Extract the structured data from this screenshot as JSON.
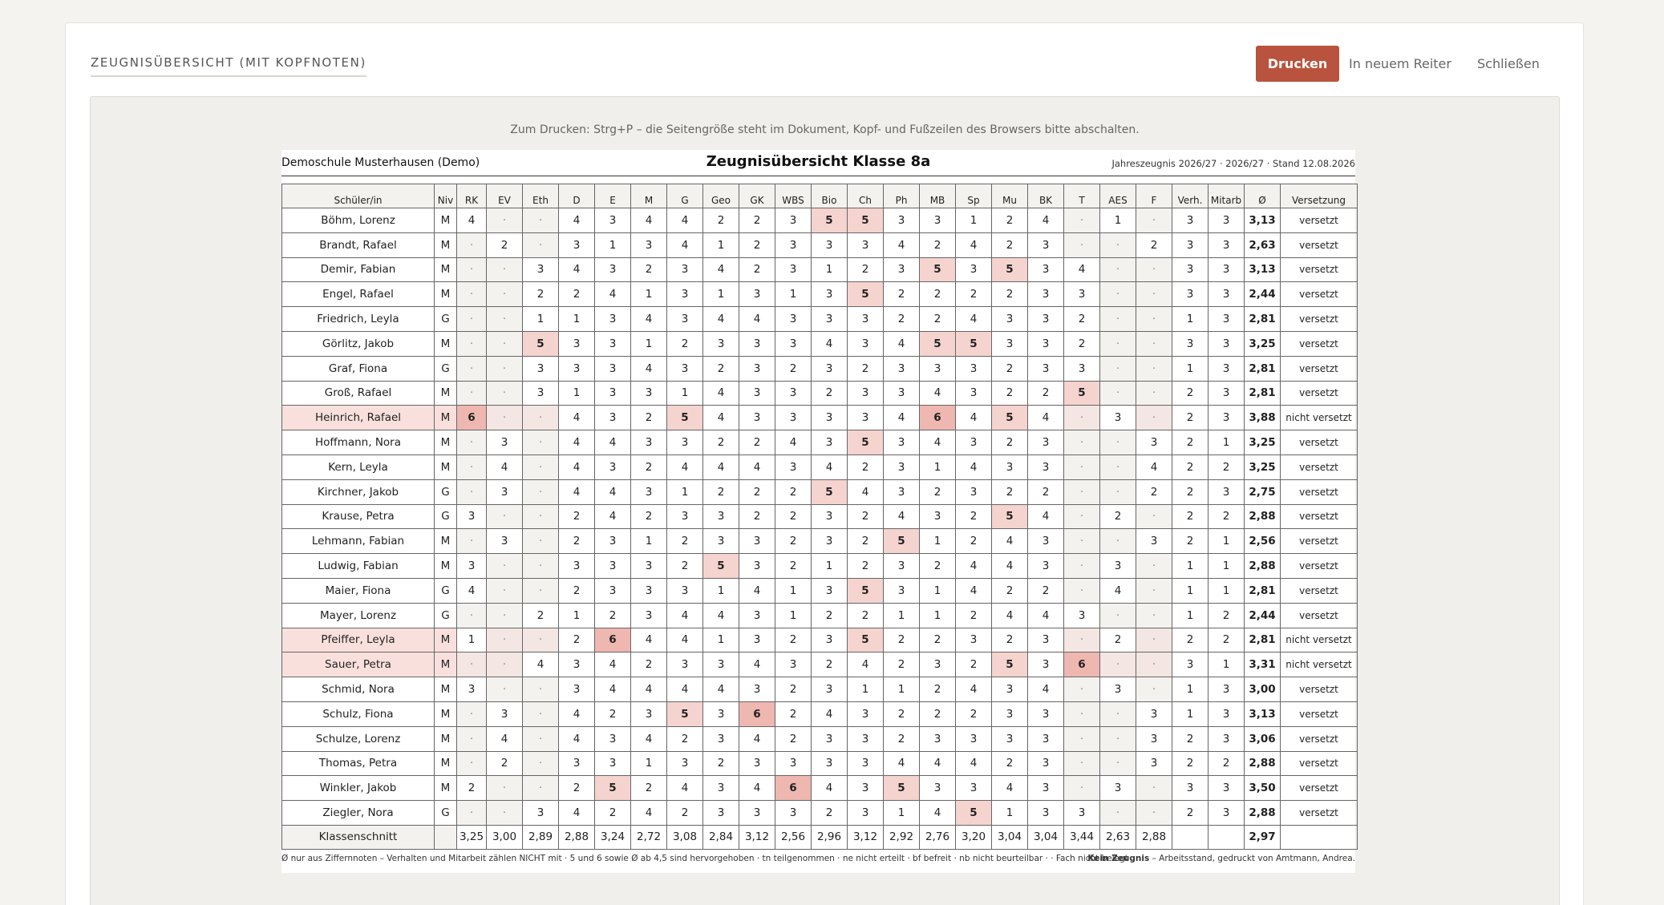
{
  "header": {
    "title": "ZEUGNISÜBERSICHT (MIT KOPFNOTEN)",
    "print_label": "Drucken",
    "newtab_label": "In neuem Reiter",
    "close_label": "Schließen"
  },
  "colors": {
    "accent": "#b9533d",
    "grade5": "#f5d3cf",
    "grade6": "#eeb7b0",
    "failed_row": "#f9e0dd"
  },
  "preview": {
    "hint": "Zum Drucken: Strg+P – die Seitengröße steht im Dokument, Kopf- und Fußzeilen des Browsers bitte abschalten."
  },
  "sheet": {
    "school": "Demoschule Musterhausen (Demo)",
    "title": "Zeugnisübersicht Klasse 8a",
    "meta": "Jahreszeugnis 2026/27 · 2026/27 · Stand 12.08.2026",
    "headers": [
      "Schüler/in",
      "Niv",
      "RK",
      "EV",
      "Eth",
      "D",
      "E",
      "M",
      "G",
      "Geo",
      "GK",
      "WBS",
      "Bio",
      "Ch",
      "Ph",
      "MB",
      "Sp",
      "Mu",
      "BK",
      "T",
      "AES",
      "F",
      "Verh.",
      "Mitarb",
      "Ø",
      "Versetzung"
    ],
    "rows": [
      {
        "name": "Böhm, Lorenz",
        "niv": "M",
        "grades": [
          "4",
          "·",
          "·",
          "4",
          "3",
          "4",
          "4",
          "2",
          "2",
          "3",
          "5",
          "5",
          "3",
          "3",
          "1",
          "2",
          "4",
          "·",
          "1",
          "·"
        ],
        "verh": "3",
        "mitarb": "3",
        "avg": "3,13",
        "status": "versetzt"
      },
      {
        "name": "Brandt, Rafael",
        "niv": "M",
        "grades": [
          "·",
          "2",
          "·",
          "3",
          "1",
          "3",
          "4",
          "1",
          "2",
          "3",
          "3",
          "3",
          "4",
          "2",
          "4",
          "2",
          "3",
          "·",
          "·",
          "2"
        ],
        "verh": "3",
        "mitarb": "3",
        "avg": "2,63",
        "status": "versetzt"
      },
      {
        "name": "Demir, Fabian",
        "niv": "M",
        "grades": [
          "·",
          "·",
          "3",
          "4",
          "3",
          "2",
          "3",
          "4",
          "2",
          "3",
          "1",
          "2",
          "3",
          "5",
          "3",
          "5",
          "3",
          "4",
          "·",
          "·"
        ],
        "verh": "3",
        "mitarb": "3",
        "avg": "3,13",
        "status": "versetzt"
      },
      {
        "name": "Engel, Rafael",
        "niv": "M",
        "grades": [
          "·",
          "·",
          "2",
          "2",
          "4",
          "1",
          "3",
          "1",
          "3",
          "1",
          "3",
          "5",
          "2",
          "2",
          "2",
          "2",
          "3",
          "3",
          "·",
          "·"
        ],
        "verh": "3",
        "mitarb": "3",
        "avg": "2,44",
        "status": "versetzt"
      },
      {
        "name": "Friedrich, Leyla",
        "niv": "G",
        "grades": [
          "·",
          "·",
          "1",
          "1",
          "3",
          "4",
          "3",
          "4",
          "4",
          "3",
          "3",
          "3",
          "2",
          "2",
          "4",
          "3",
          "3",
          "2",
          "·",
          "·"
        ],
        "verh": "1",
        "mitarb": "3",
        "avg": "2,81",
        "status": "versetzt"
      },
      {
        "name": "Görlitz, Jakob",
        "niv": "M",
        "grades": [
          "·",
          "·",
          "5",
          "3",
          "3",
          "1",
          "2",
          "3",
          "3",
          "3",
          "4",
          "3",
          "4",
          "5",
          "5",
          "3",
          "3",
          "2",
          "·",
          "·"
        ],
        "verh": "3",
        "mitarb": "3",
        "avg": "3,25",
        "status": "versetzt"
      },
      {
        "name": "Graf, Fiona",
        "niv": "G",
        "grades": [
          "·",
          "·",
          "3",
          "3",
          "3",
          "4",
          "3",
          "2",
          "3",
          "2",
          "3",
          "2",
          "3",
          "3",
          "3",
          "2",
          "3",
          "3",
          "·",
          "·"
        ],
        "verh": "1",
        "mitarb": "3",
        "avg": "2,81",
        "status": "versetzt"
      },
      {
        "name": "Groß, Rafael",
        "niv": "M",
        "grades": [
          "·",
          "·",
          "3",
          "1",
          "3",
          "3",
          "1",
          "4",
          "3",
          "3",
          "2",
          "3",
          "3",
          "4",
          "3",
          "2",
          "2",
          "5",
          "·",
          "·"
        ],
        "verh": "2",
        "mitarb": "3",
        "avg": "2,81",
        "status": "versetzt"
      },
      {
        "name": "Heinrich, Rafael",
        "niv": "M",
        "grades": [
          "6",
          "·",
          "·",
          "4",
          "3",
          "2",
          "5",
          "4",
          "3",
          "3",
          "3",
          "3",
          "4",
          "6",
          "4",
          "5",
          "4",
          "·",
          "3",
          "·"
        ],
        "verh": "2",
        "mitarb": "3",
        "avg": "3,88",
        "status": "nicht versetzt"
      },
      {
        "name": "Hoffmann, Nora",
        "niv": "M",
        "grades": [
          "·",
          "3",
          "·",
          "4",
          "4",
          "3",
          "3",
          "2",
          "2",
          "4",
          "3",
          "5",
          "3",
          "4",
          "3",
          "2",
          "3",
          "·",
          "·",
          "3"
        ],
        "verh": "2",
        "mitarb": "1",
        "avg": "3,25",
        "status": "versetzt"
      },
      {
        "name": "Kern, Leyla",
        "niv": "M",
        "grades": [
          "·",
          "4",
          "·",
          "4",
          "3",
          "2",
          "4",
          "4",
          "4",
          "3",
          "4",
          "2",
          "3",
          "1",
          "4",
          "3",
          "3",
          "·",
          "·",
          "4"
        ],
        "verh": "2",
        "mitarb": "2",
        "avg": "3,25",
        "status": "versetzt"
      },
      {
        "name": "Kirchner, Jakob",
        "niv": "G",
        "grades": [
          "·",
          "3",
          "·",
          "4",
          "4",
          "3",
          "1",
          "2",
          "2",
          "2",
          "5",
          "4",
          "3",
          "2",
          "3",
          "2",
          "2",
          "·",
          "·",
          "2"
        ],
        "verh": "2",
        "mitarb": "3",
        "avg": "2,75",
        "status": "versetzt"
      },
      {
        "name": "Krause, Petra",
        "niv": "G",
        "grades": [
          "3",
          "·",
          "·",
          "2",
          "4",
          "2",
          "3",
          "3",
          "2",
          "2",
          "3",
          "2",
          "4",
          "3",
          "2",
          "5",
          "4",
          "·",
          "2",
          "·"
        ],
        "verh": "2",
        "mitarb": "2",
        "avg": "2,88",
        "status": "versetzt"
      },
      {
        "name": "Lehmann, Fabian",
        "niv": "M",
        "grades": [
          "·",
          "3",
          "·",
          "2",
          "3",
          "1",
          "2",
          "3",
          "3",
          "2",
          "3",
          "2",
          "5",
          "1",
          "2",
          "4",
          "3",
          "·",
          "·",
          "3"
        ],
        "verh": "2",
        "mitarb": "1",
        "avg": "2,56",
        "status": "versetzt"
      },
      {
        "name": "Ludwig, Fabian",
        "niv": "M",
        "grades": [
          "3",
          "·",
          "·",
          "3",
          "3",
          "3",
          "2",
          "5",
          "3",
          "2",
          "1",
          "2",
          "3",
          "2",
          "4",
          "4",
          "3",
          "·",
          "3",
          "·"
        ],
        "verh": "1",
        "mitarb": "1",
        "avg": "2,88",
        "status": "versetzt"
      },
      {
        "name": "Maier, Fiona",
        "niv": "G",
        "grades": [
          "4",
          "·",
          "·",
          "2",
          "3",
          "3",
          "3",
          "1",
          "4",
          "1",
          "3",
          "5",
          "3",
          "1",
          "4",
          "2",
          "2",
          "·",
          "4",
          "·"
        ],
        "verh": "1",
        "mitarb": "1",
        "avg": "2,81",
        "status": "versetzt"
      },
      {
        "name": "Mayer, Lorenz",
        "niv": "G",
        "grades": [
          "·",
          "·",
          "2",
          "1",
          "2",
          "3",
          "4",
          "4",
          "3",
          "1",
          "2",
          "2",
          "1",
          "1",
          "2",
          "4",
          "4",
          "3",
          "·",
          "·"
        ],
        "verh": "1",
        "mitarb": "2",
        "avg": "2,44",
        "status": "versetzt"
      },
      {
        "name": "Pfeiffer, Leyla",
        "niv": "M",
        "grades": [
          "1",
          "·",
          "·",
          "2",
          "6",
          "4",
          "4",
          "1",
          "3",
          "2",
          "3",
          "5",
          "2",
          "2",
          "3",
          "2",
          "3",
          "·",
          "2",
          "·"
        ],
        "verh": "2",
        "mitarb": "2",
        "avg": "2,81",
        "status": "nicht versetzt"
      },
      {
        "name": "Sauer, Petra",
        "niv": "M",
        "grades": [
          "·",
          "·",
          "4",
          "3",
          "4",
          "2",
          "3",
          "3",
          "4",
          "3",
          "2",
          "4",
          "2",
          "3",
          "2",
          "5",
          "3",
          "6",
          "·",
          "·"
        ],
        "verh": "3",
        "mitarb": "1",
        "avg": "3,31",
        "status": "nicht versetzt"
      },
      {
        "name": "Schmid, Nora",
        "niv": "M",
        "grades": [
          "3",
          "·",
          "·",
          "3",
          "4",
          "4",
          "4",
          "4",
          "3",
          "2",
          "3",
          "1",
          "1",
          "2",
          "4",
          "3",
          "4",
          "·",
          "3",
          "·"
        ],
        "verh": "1",
        "mitarb": "3",
        "avg": "3,00",
        "status": "versetzt"
      },
      {
        "name": "Schulz, Fiona",
        "niv": "M",
        "grades": [
          "·",
          "3",
          "·",
          "4",
          "2",
          "3",
          "5",
          "3",
          "6",
          "2",
          "4",
          "3",
          "2",
          "2",
          "2",
          "3",
          "3",
          "·",
          "·",
          "3"
        ],
        "verh": "1",
        "mitarb": "3",
        "avg": "3,13",
        "status": "versetzt"
      },
      {
        "name": "Schulze, Lorenz",
        "niv": "M",
        "grades": [
          "·",
          "4",
          "·",
          "4",
          "3",
          "4",
          "2",
          "3",
          "4",
          "2",
          "3",
          "3",
          "2",
          "3",
          "3",
          "3",
          "3",
          "·",
          "·",
          "3"
        ],
        "verh": "2",
        "mitarb": "3",
        "avg": "3,06",
        "status": "versetzt"
      },
      {
        "name": "Thomas, Petra",
        "niv": "M",
        "grades": [
          "·",
          "2",
          "·",
          "3",
          "3",
          "1",
          "3",
          "2",
          "3",
          "3",
          "3",
          "3",
          "4",
          "4",
          "4",
          "2",
          "3",
          "·",
          "·",
          "3"
        ],
        "verh": "2",
        "mitarb": "2",
        "avg": "2,88",
        "status": "versetzt"
      },
      {
        "name": "Winkler, Jakob",
        "niv": "M",
        "grades": [
          "2",
          "·",
          "·",
          "2",
          "5",
          "2",
          "4",
          "3",
          "4",
          "6",
          "4",
          "3",
          "5",
          "3",
          "3",
          "4",
          "3",
          "·",
          "3",
          "·"
        ],
        "verh": "3",
        "mitarb": "3",
        "avg": "3,50",
        "status": "versetzt"
      },
      {
        "name": "Ziegler, Nora",
        "niv": "G",
        "grades": [
          "·",
          "·",
          "3",
          "4",
          "2",
          "4",
          "2",
          "3",
          "3",
          "3",
          "2",
          "3",
          "1",
          "4",
          "5",
          "1",
          "3",
          "3",
          "·",
          "·"
        ],
        "verh": "2",
        "mitarb": "3",
        "avg": "2,88",
        "status": "versetzt"
      }
    ],
    "class_avg": {
      "label": "Klassenschnitt",
      "values": [
        "3,25",
        "3,00",
        "2,89",
        "2,88",
        "3,24",
        "2,72",
        "3,08",
        "2,84",
        "3,12",
        "2,56",
        "2,96",
        "3,12",
        "2,92",
        "2,76",
        "3,20",
        "3,04",
        "3,04",
        "3,44",
        "2,63",
        "2,88"
      ],
      "overall": "2,97"
    },
    "footer_left": "Ø nur aus Ziffernnoten – Verhalten und Mitarbeit zählen NICHT mit · 5 und 6 sowie Ø ab 4,5 sind hervorgehoben · tn teilgenommen · ne nicht erteilt · bf befreit · nb nicht beurteilbar · · Fach nicht belegt",
    "footer_right_bold": "Kein Zeugnis",
    "footer_right": " – Arbeitsstand, gedruckt von Amtmann, Andrea."
  }
}
